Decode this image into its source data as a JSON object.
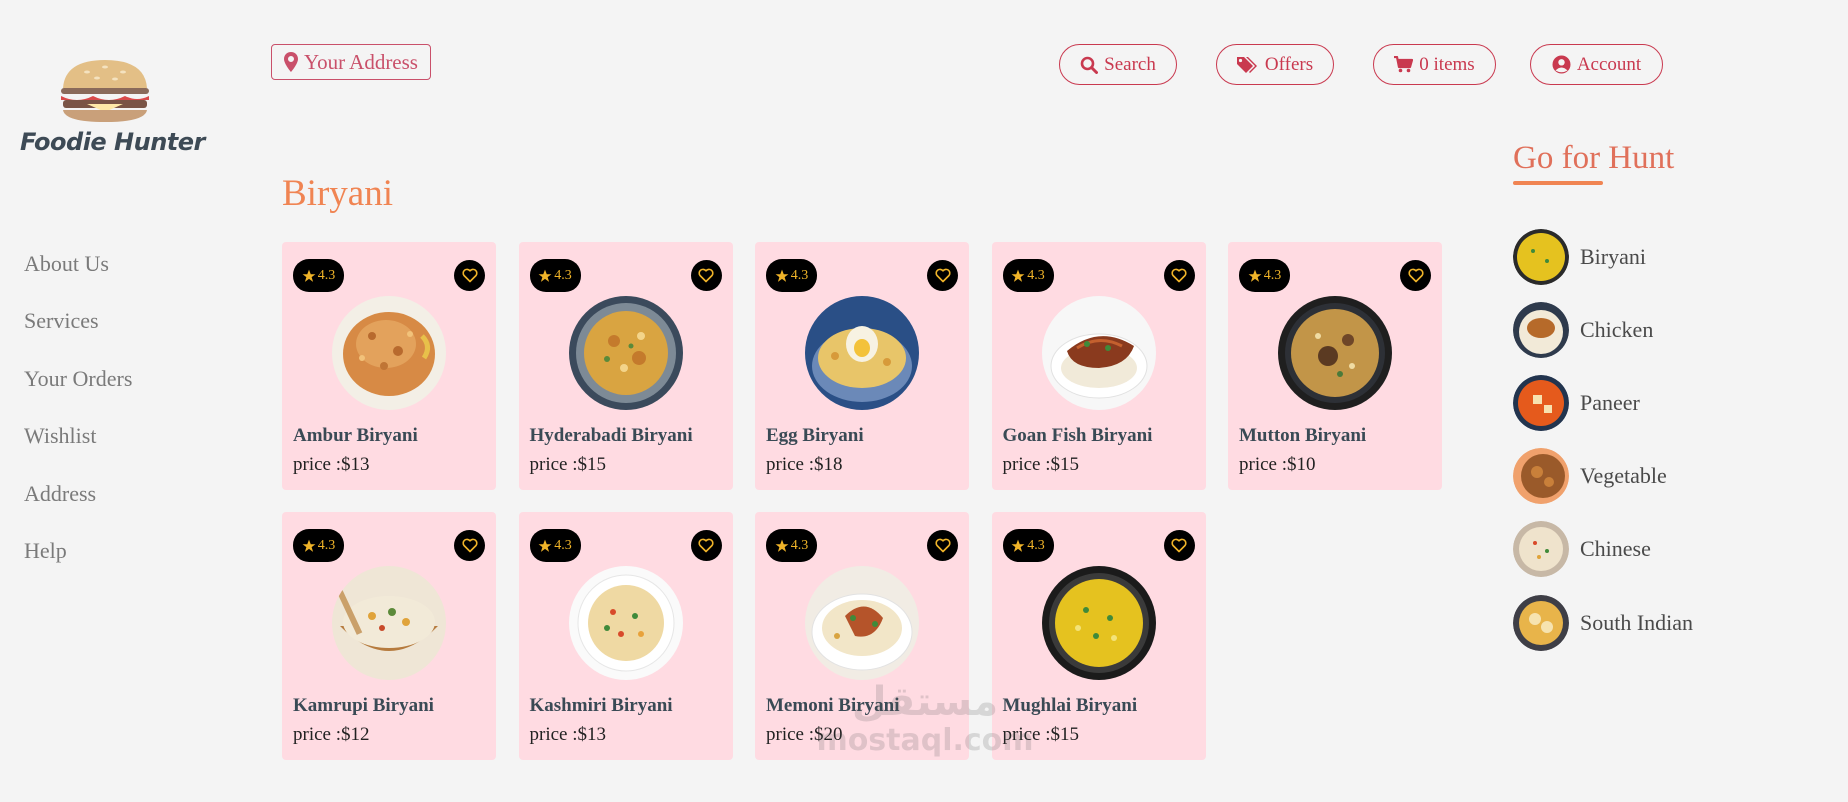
{
  "brand": {
    "name": "Foodie Hunter"
  },
  "left_nav": [
    {
      "label": "About Us"
    },
    {
      "label": "Services"
    },
    {
      "label": "Your Orders"
    },
    {
      "label": "Wishlist"
    },
    {
      "label": "Address"
    },
    {
      "label": "Help"
    }
  ],
  "header": {
    "address_label": "Your Address",
    "search_label": "Search",
    "offers_label": "Offers",
    "cart_label": "0 items",
    "account_label": "Account"
  },
  "section": {
    "title": "Biryani"
  },
  "dishes": [
    {
      "name": "Ambur Biryani",
      "price": "price :$13",
      "rating": "4.3"
    },
    {
      "name": "Hyderabadi Biryani",
      "price": "price :$15",
      "rating": "4.3"
    },
    {
      "name": "Egg Biryani",
      "price": "price :$18",
      "rating": "4.3"
    },
    {
      "name": "Goan Fish Biryani",
      "price": "price :$15",
      "rating": "4.3"
    },
    {
      "name": "Mutton Biryani",
      "price": "price :$10",
      "rating": "4.3"
    },
    {
      "name": "Kamrupi Biryani",
      "price": "price :$12",
      "rating": "4.3"
    },
    {
      "name": "Kashmiri Biryani",
      "price": "price :$13",
      "rating": "4.3"
    },
    {
      "name": "Memoni Biryani",
      "price": "price :$20",
      "rating": "4.3"
    },
    {
      "name": "Mughlai Biryani",
      "price": "price :$15",
      "rating": "4.3"
    }
  ],
  "categories": {
    "title": "Go for Hunt",
    "items": [
      {
        "label": "Biryani"
      },
      {
        "label": "Chicken"
      },
      {
        "label": "Paneer"
      },
      {
        "label": "Vegetable"
      },
      {
        "label": "Chinese"
      },
      {
        "label": "South Indian"
      }
    ]
  },
  "watermark": {
    "arabic": "مستقل",
    "latin": "mostaql.com"
  },
  "colors": {
    "accent_orange": "#f08452",
    "accent_red": "#c9394f",
    "card_bg": "#ffdbe2",
    "page_bg": "#f4f4f4",
    "star": "#f0b429"
  },
  "icons": {
    "address": "map-marker-icon",
    "search": "search-icon",
    "offers": "tags-icon",
    "cart": "cart-icon",
    "account": "user-circle-icon",
    "rating": "star-icon",
    "wishlist": "heart-icon"
  }
}
